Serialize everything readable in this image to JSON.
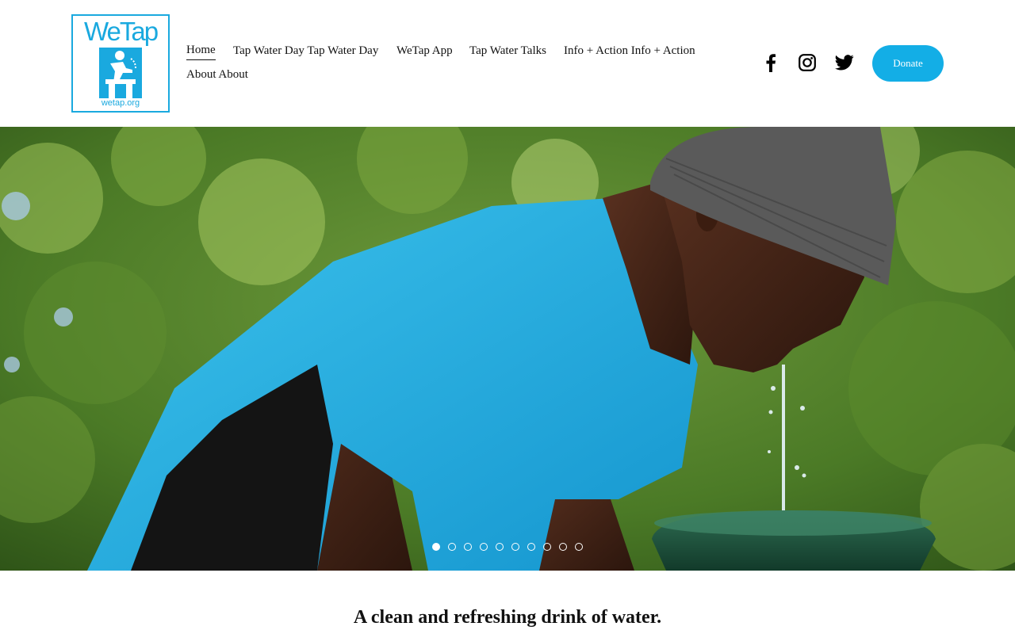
{
  "brand": {
    "logo_text": "WeTap",
    "logo_url_text": "wetap.org",
    "accent_color": "#1aa9df",
    "button_color": "#13aee6"
  },
  "nav": {
    "items": [
      {
        "label": "Home",
        "active": true
      },
      {
        "label": "Tap Water Day Tap Water Day"
      },
      {
        "label": "WeTap App"
      },
      {
        "label": "Tap Water Talks"
      },
      {
        "label": "Info + Action Info + Action"
      },
      {
        "label": "About About"
      }
    ]
  },
  "social": [
    {
      "icon": "facebook-icon"
    },
    {
      "icon": "instagram-icon"
    },
    {
      "icon": "twitter-icon"
    }
  ],
  "donate": {
    "label": "Donate"
  },
  "hero": {
    "slide_count": 10,
    "active_slide": 1
  },
  "tagline": "A clean and refreshing drink of water."
}
